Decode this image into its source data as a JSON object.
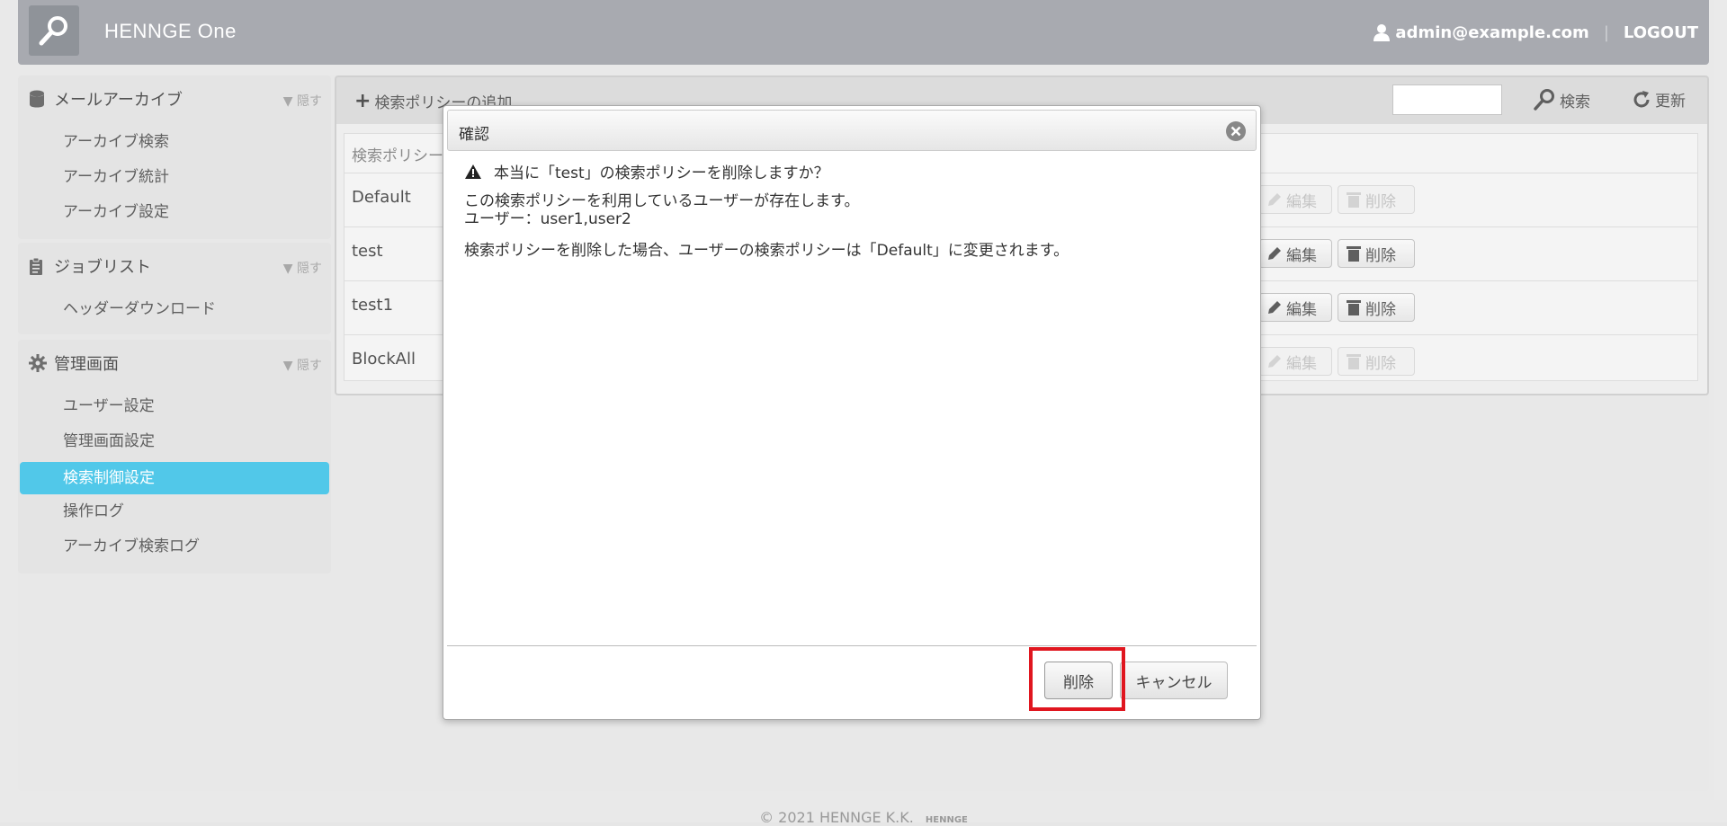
{
  "header": {
    "brand": "HENNGE One",
    "logo_icon": "search-icon",
    "user_icon": "user-icon",
    "user_email": "admin@example.com",
    "separator": "|",
    "logout_label": "LOGOUT"
  },
  "sidebar": {
    "sections": [
      {
        "title": "メールアーカイブ",
        "icon": "database-icon",
        "hide_label": "▼ 隠す",
        "items": [
          "アーカイブ検索",
          "アーカイブ統計",
          "アーカイブ設定"
        ]
      },
      {
        "title": "ジョブリスト",
        "icon": "clipboard-icon",
        "hide_label": "▼ 隠す",
        "items": [
          "ヘッダーダウンロード"
        ]
      },
      {
        "title": "管理画面",
        "icon": "gear-icon",
        "hide_label": "▼ 隠す",
        "items": [
          "ユーザー設定",
          "管理画面設定",
          "検索制御設定",
          "操作ログ",
          "アーカイブ検索ログ"
        ],
        "active_item": "検索制御設定"
      }
    ]
  },
  "toolbar": {
    "add_label": "検索ポリシーの追加",
    "search_value": "",
    "search_label": "検索",
    "refresh_label": "更新"
  },
  "table": {
    "header_name": "検索ポリシー",
    "edit_label": "編集",
    "delete_label": "削除",
    "rows": [
      {
        "name": "Default",
        "enabled": false
      },
      {
        "name": "test",
        "enabled": true
      },
      {
        "name": "test1",
        "enabled": true
      },
      {
        "name": "BlockAll",
        "enabled": false
      }
    ]
  },
  "dialog": {
    "title": "確認",
    "close_icon": "close-icon",
    "warning_icon": "warning-icon",
    "question": "本当に「test」の検索ポリシーを削除しますか？",
    "message_line1": "この検索ポリシーを利用しているユーザーが存在します。",
    "message_line2": "ユーザー：user1,user2",
    "message_line3": "検索ポリシーを削除した場合、ユーザーの検索ポリシーは「Default」に変更されます。",
    "delete_button": "削除",
    "cancel_button": "キャンセル",
    "highlight_color": "#e0161f"
  },
  "footer": {
    "copyright": "© 2021 HENNGE K.K.",
    "logo_text": "HENNGE"
  }
}
